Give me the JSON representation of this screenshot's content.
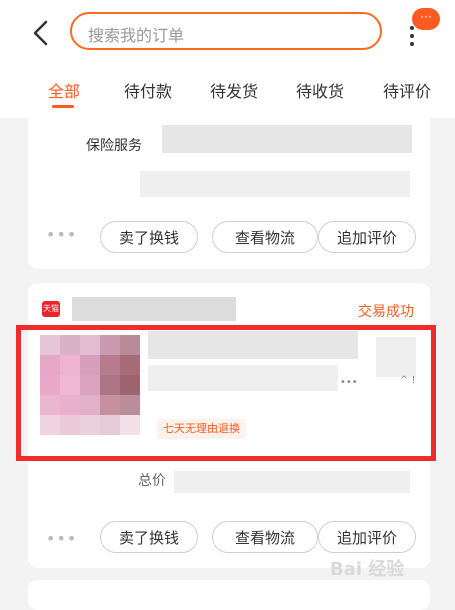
{
  "header": {
    "back_icon": "chevron-left-icon",
    "search_placeholder": "搜索我的订单",
    "message_badge": "···"
  },
  "tabs": [
    {
      "label": "全部",
      "active": true
    },
    {
      "label": "待付款",
      "active": false
    },
    {
      "label": "待发货",
      "active": false
    },
    {
      "label": "待收货",
      "active": false
    },
    {
      "label": "待评价",
      "active": false
    }
  ],
  "order1": {
    "insurance_label": "保险服务",
    "more": "•••",
    "buttons": [
      "卖了换钱",
      "查看物流",
      "追加评价"
    ]
  },
  "order2": {
    "store_icon_text": "天猫",
    "status": "交易成功",
    "tag": "七天无理由退换",
    "more_inline": "•••",
    "caret": "^ !",
    "total_label": "总价",
    "more": "•••",
    "buttons": [
      "卖了换钱",
      "查看物流",
      "追加评价"
    ]
  },
  "watermark": "Bai 经验",
  "colors": {
    "accent": "#ff5a1f",
    "highlight": "#ef2b2b"
  }
}
